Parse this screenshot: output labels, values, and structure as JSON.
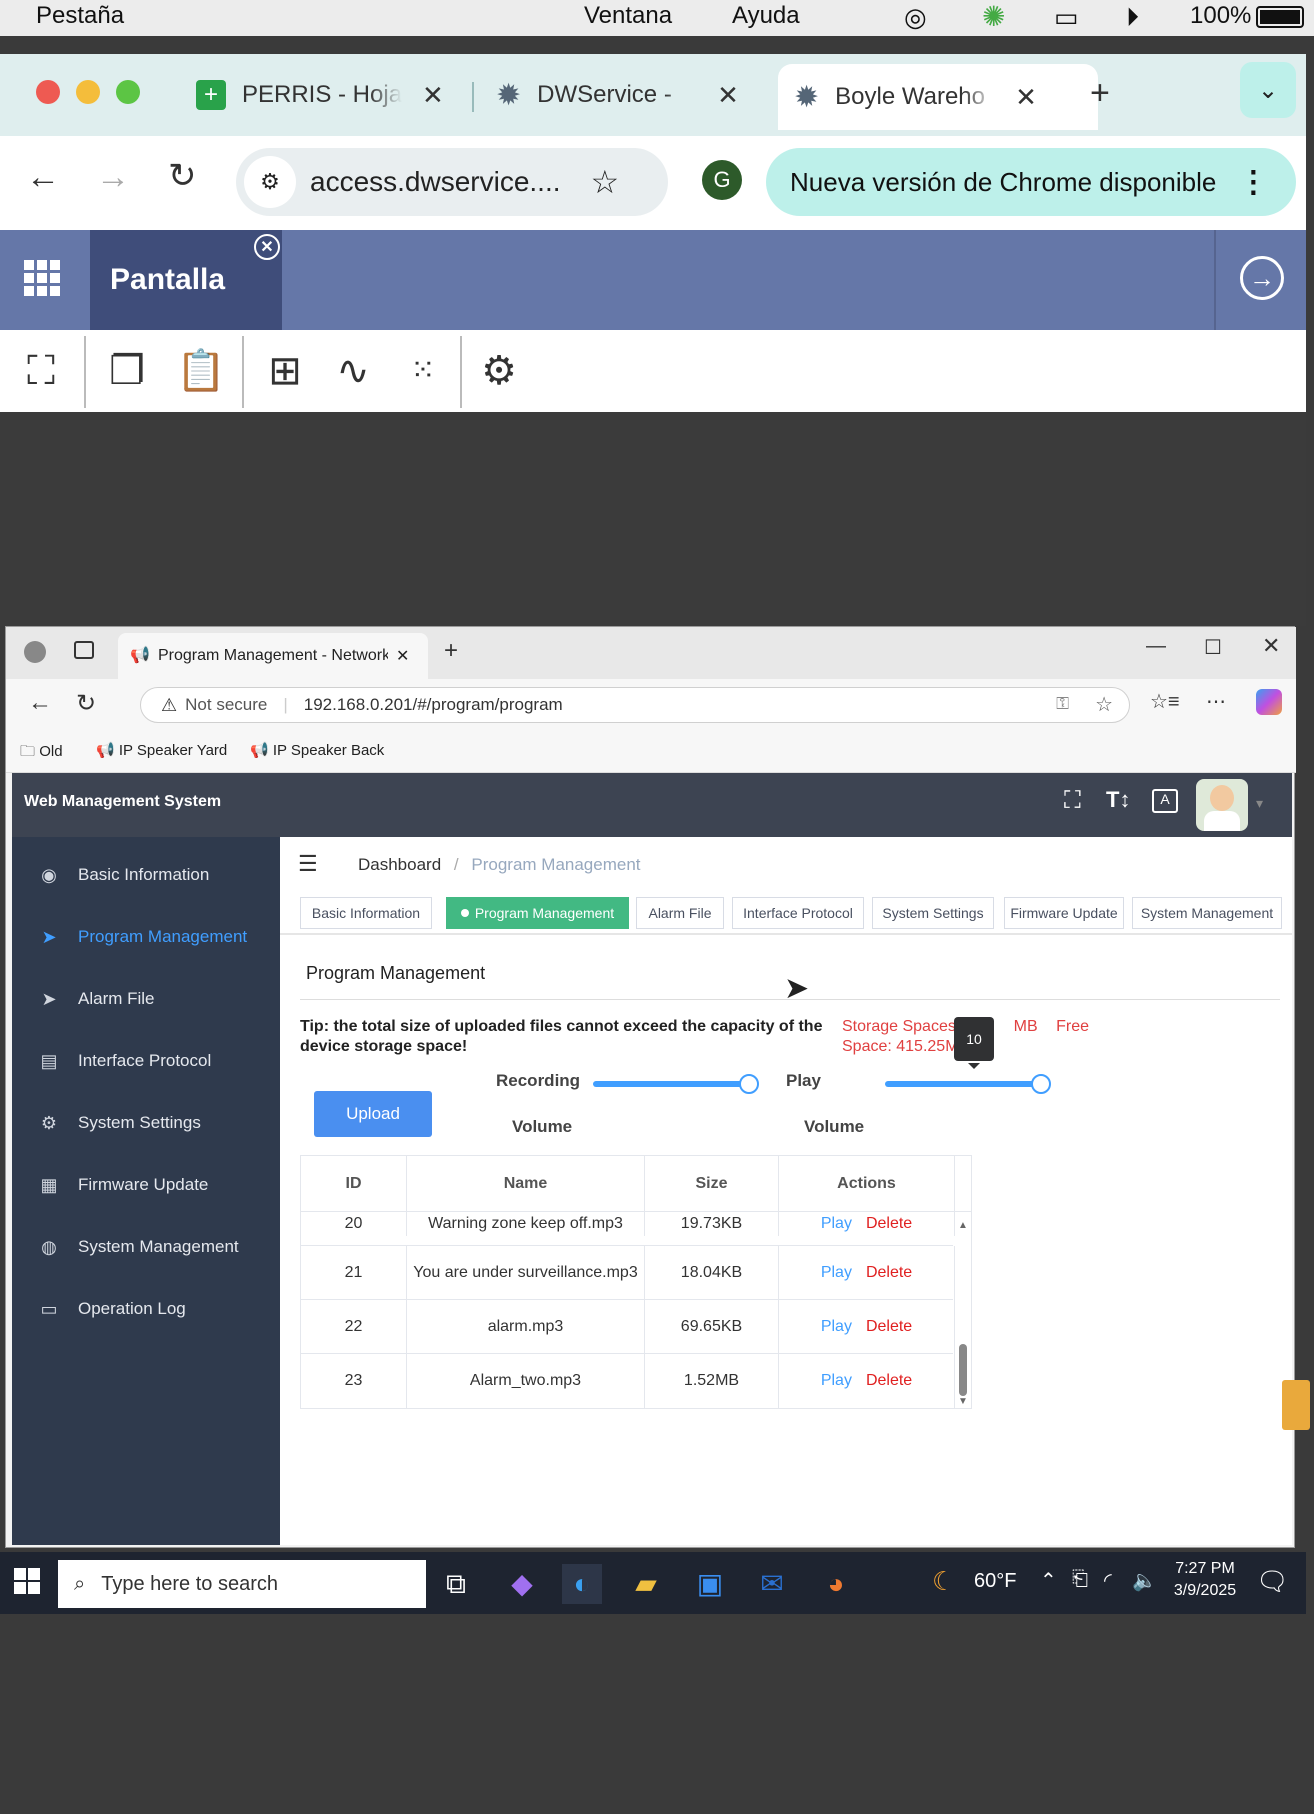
{
  "mac_menubar": {
    "items": [
      "Pestaña",
      "Ventana",
      "Ayuda"
    ],
    "battery": "100%"
  },
  "chrome": {
    "tabs": [
      {
        "label": "PERRIS - Hoja",
        "icon": "sheets-icon"
      },
      {
        "label": "DWService - ",
        "icon": "gear-icon"
      },
      {
        "label": "Boyle Wareho",
        "icon": "gear-icon"
      }
    ],
    "url": "access.dwservice....",
    "profile_initial": "G",
    "update_label": "Nueva versión de Chrome disponible"
  },
  "dwservice": {
    "screen_tab": "Pantalla"
  },
  "edge": {
    "tab_title": "Program Management - Network",
    "not_secure": "Not secure",
    "url": "192.168.0.201/#/program/program",
    "bookmarks": [
      "Old",
      "IP Speaker Yard",
      "IP Speaker Back"
    ]
  },
  "app": {
    "title": "Web Management System",
    "sidebar": [
      {
        "label": "Basic Information",
        "icon": "dashboard-icon"
      },
      {
        "label": "Program Management",
        "icon": "send-icon",
        "active": true
      },
      {
        "label": "Alarm File",
        "icon": "send-icon"
      },
      {
        "label": "Interface Protocol",
        "icon": "document-icon"
      },
      {
        "label": "System Settings",
        "icon": "gear-icon"
      },
      {
        "label": "Firmware Update",
        "icon": "grid-icon"
      },
      {
        "label": "System Management",
        "icon": "globe-icon"
      },
      {
        "label": "Operation Log",
        "icon": "log-icon"
      }
    ],
    "breadcrumb": {
      "home": "Dashboard",
      "sep": "/",
      "current": "Program Management"
    },
    "tags": [
      "Basic Information",
      "Program Management",
      "Alarm File",
      "Interface Protocol",
      "System Settings",
      "Firmware Update",
      "System Management"
    ],
    "content_title": "Program Management",
    "tip": "Tip: the total size of uploaded files cannot exceed the capacity of the device storage space!",
    "storage_label": "Storage Spaces: 5",
    "storage_suffix": "MB",
    "free_space": "Free Space: 415.25MB",
    "upload": "Upload",
    "recording_label": "Recording",
    "recording_vol": "Volume",
    "play_label": "Play",
    "play_vol": "Volume",
    "tooltip": "10",
    "recording_value": 1.0,
    "play_value": 1.0,
    "table": {
      "headers": [
        "ID",
        "Name",
        "Size",
        "Actions"
      ],
      "rows": [
        {
          "id": "20",
          "name": "Warning zone keep off.mp3",
          "size": "19.73KB"
        },
        {
          "id": "21",
          "name": "You are under surveillance.mp3",
          "size": "18.04KB"
        },
        {
          "id": "22",
          "name": "alarm.mp3",
          "size": "69.65KB"
        },
        {
          "id": "23",
          "name": "Alarm_two.mp3",
          "size": "1.52MB"
        }
      ],
      "play": "Play",
      "delete": "Delete"
    }
  },
  "taskbar": {
    "search_placeholder": "Type here to search",
    "weather": "60°F",
    "time": "7:27 PM",
    "date": "3/9/2025"
  }
}
